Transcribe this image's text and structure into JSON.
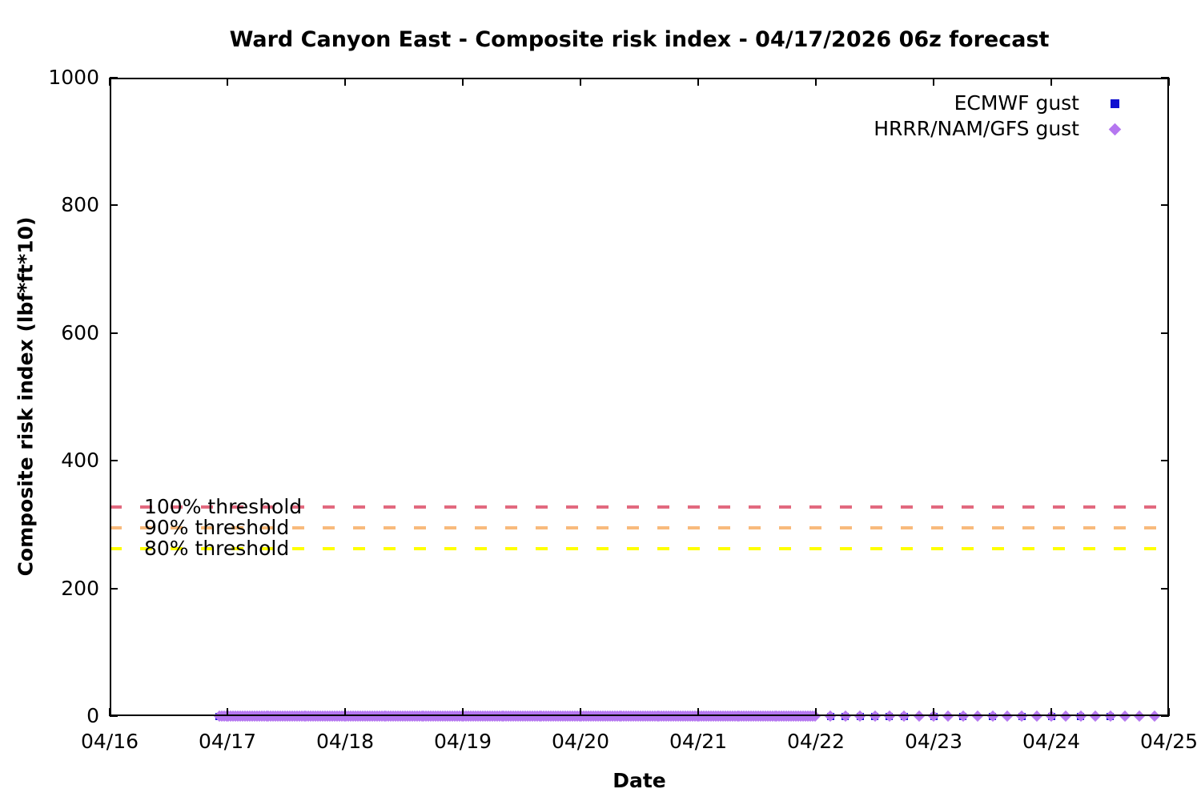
{
  "chart_data": {
    "type": "scatter",
    "title": "Ward Canyon East - Composite risk index - 04/17/2026 06z forecast",
    "xlabel": "Date",
    "ylabel": "Composite risk index (lbf*ft*10)",
    "x_tick_labels": [
      "04/16",
      "04/17",
      "04/18",
      "04/19",
      "04/20",
      "04/21",
      "04/22",
      "04/23",
      "04/24",
      "04/25"
    ],
    "x_range_days": [
      0,
      9
    ],
    "y_ticks": [
      0,
      200,
      400,
      600,
      800,
      1000
    ],
    "ylim": [
      0,
      1000
    ],
    "grid": false,
    "legend_position": "top-right",
    "thresholds": [
      {
        "label": "100% threshold",
        "value": 328,
        "color": "#e2697f"
      },
      {
        "label": "90% threshold",
        "value": 295,
        "color": "#f8ba7c"
      },
      {
        "label": "80% threshold",
        "value": 262,
        "color": "#ffff00"
      }
    ],
    "series": [
      {
        "name": "ECMWF gust",
        "marker": "square",
        "color": "#0f0fd0",
        "y_value": 0,
        "segments": [
          {
            "start_day": 0.93,
            "end_day": 6.0,
            "step_days": 0.0416667
          },
          {
            "start_day": 6.125,
            "end_day": 6.75,
            "step_days": 0.125
          },
          {
            "start_day": 7.0,
            "end_day": 8.5,
            "step_days": 0.25
          }
        ]
      },
      {
        "name": "HRRR/NAM/GFS gust",
        "marker": "diamond",
        "color": "#b577f0",
        "y_value": 0,
        "segments": [
          {
            "start_day": 0.93,
            "end_day": 6.0,
            "step_days": 0.02
          },
          {
            "start_day": 6.125,
            "end_day": 8.875,
            "step_days": 0.125
          }
        ]
      }
    ]
  }
}
